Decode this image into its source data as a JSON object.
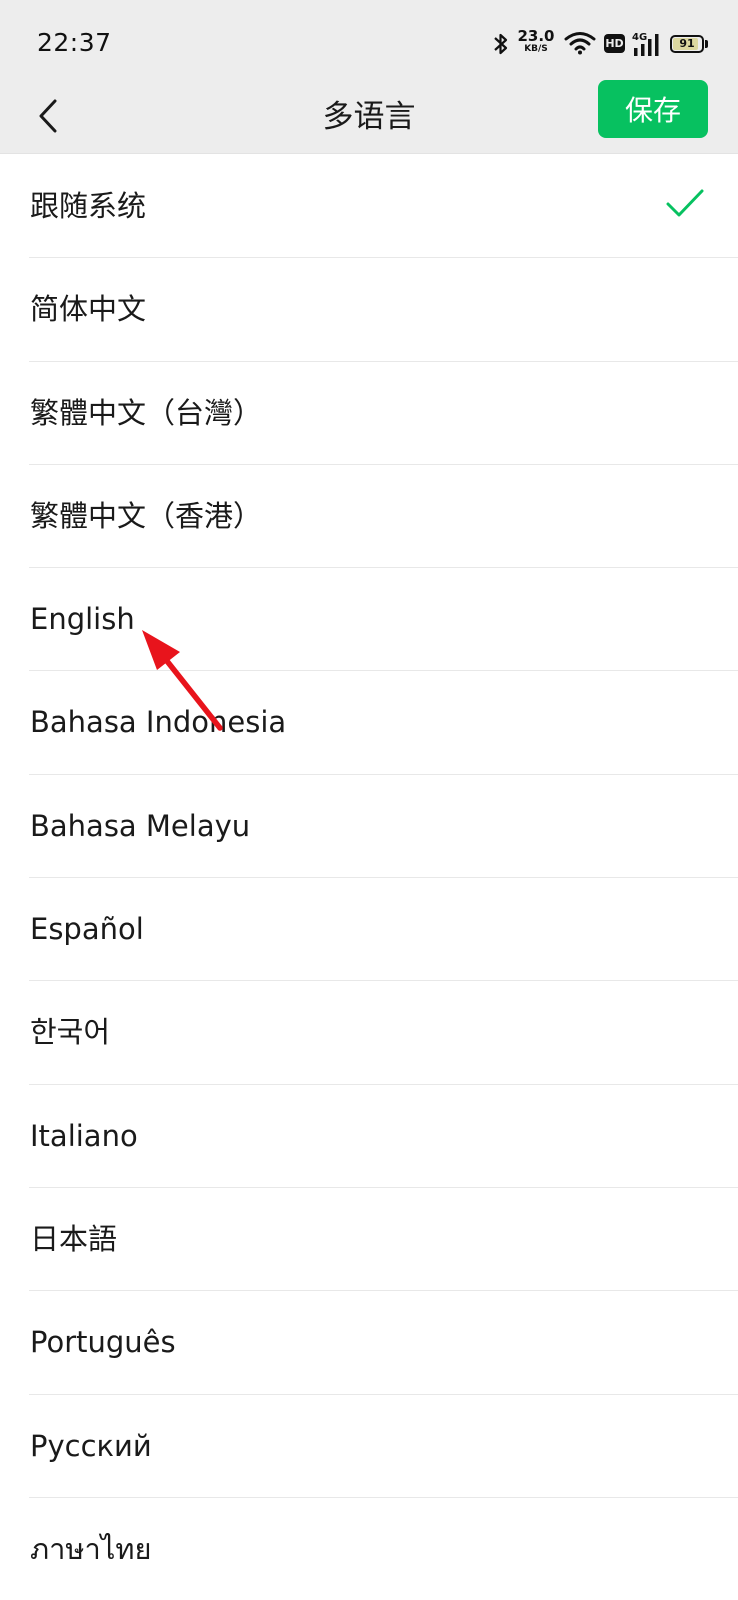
{
  "status_bar": {
    "time": "22:37",
    "net_speed": "23.0",
    "net_speed_unit": "KB/S",
    "hd_label": "HD",
    "network_type": "4G",
    "battery_level": "91",
    "icons": [
      "bluetooth-icon",
      "wifi-icon",
      "hd-icon",
      "signal-icon",
      "battery-icon"
    ]
  },
  "nav": {
    "back_icon": "chevron-left-icon",
    "title": "多语言",
    "save_label": "保存"
  },
  "languages": {
    "items": [
      {
        "label": "跟随系统",
        "selected": true
      },
      {
        "label": "简体中文",
        "selected": false
      },
      {
        "label": "繁體中文（台灣）",
        "selected": false
      },
      {
        "label": "繁體中文（香港）",
        "selected": false
      },
      {
        "label": "English",
        "selected": false
      },
      {
        "label": "Bahasa Indonesia",
        "selected": false
      },
      {
        "label": "Bahasa Melayu",
        "selected": false
      },
      {
        "label": "Español",
        "selected": false
      },
      {
        "label": "한국어",
        "selected": false
      },
      {
        "label": "Italiano",
        "selected": false
      },
      {
        "label": "日本語",
        "selected": false
      },
      {
        "label": "Português",
        "selected": false
      },
      {
        "label": "Русский",
        "selected": false
      },
      {
        "label": "ภาษาไทย",
        "selected": false
      }
    ]
  },
  "colors": {
    "accent": "#07c160",
    "header_bg": "#ededed",
    "annotation": "#e8141c"
  }
}
